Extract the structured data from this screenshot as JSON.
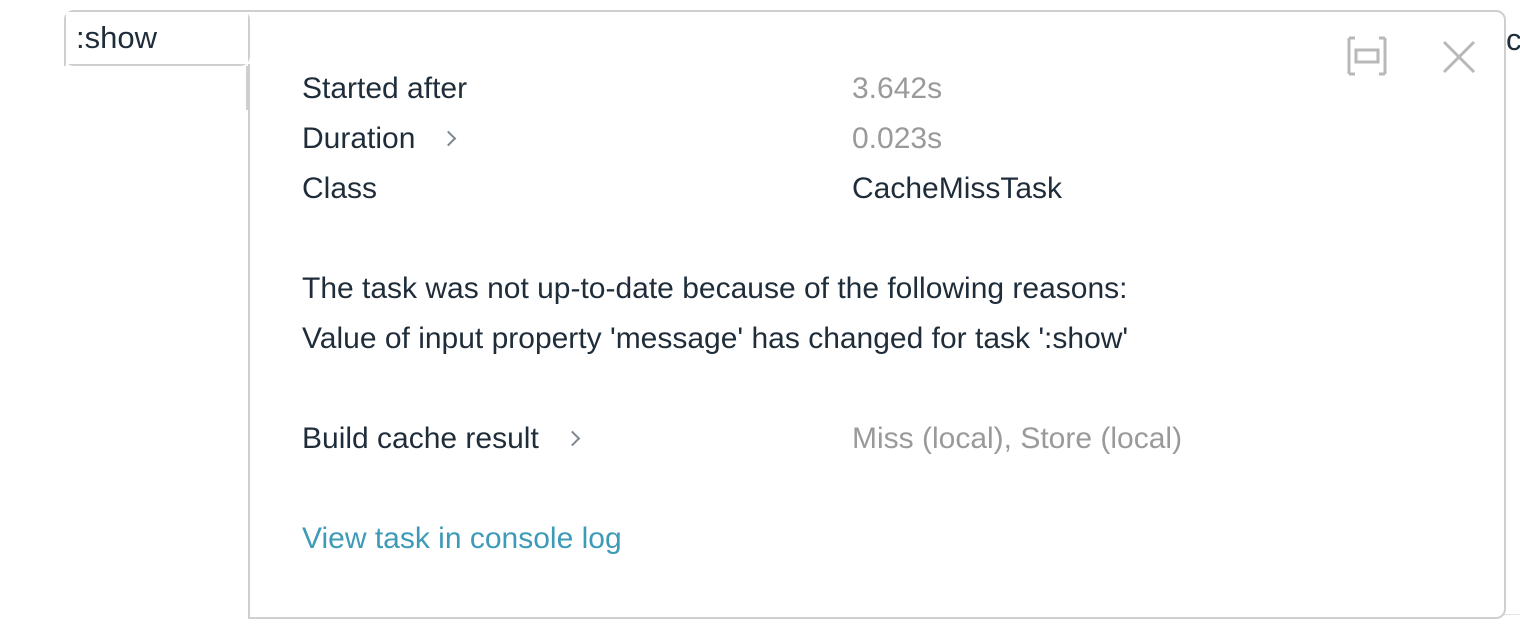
{
  "tab": {
    "label": ":show"
  },
  "right_peek": "c",
  "details": {
    "started_after": {
      "label": "Started after",
      "value": "3.642s"
    },
    "duration": {
      "label": "Duration",
      "value": "0.023s"
    },
    "class": {
      "label": "Class",
      "value": "CacheMissTask"
    },
    "reasons_heading": "The task was not up-to-date because of the following reasons:",
    "reason_1": "Value of input property 'message' has changed for task ':show'",
    "build_cache": {
      "label": "Build cache result",
      "value": "Miss (local), Store (local)"
    },
    "console_link": "View task in console log"
  },
  "icons": {
    "expand": "collapse-expand-icon",
    "close": "close-icon"
  },
  "colors": {
    "text": "#1f2d3a",
    "muted": "#9a9a9a",
    "link": "#3d9bb7",
    "border": "#cfcfcf"
  }
}
